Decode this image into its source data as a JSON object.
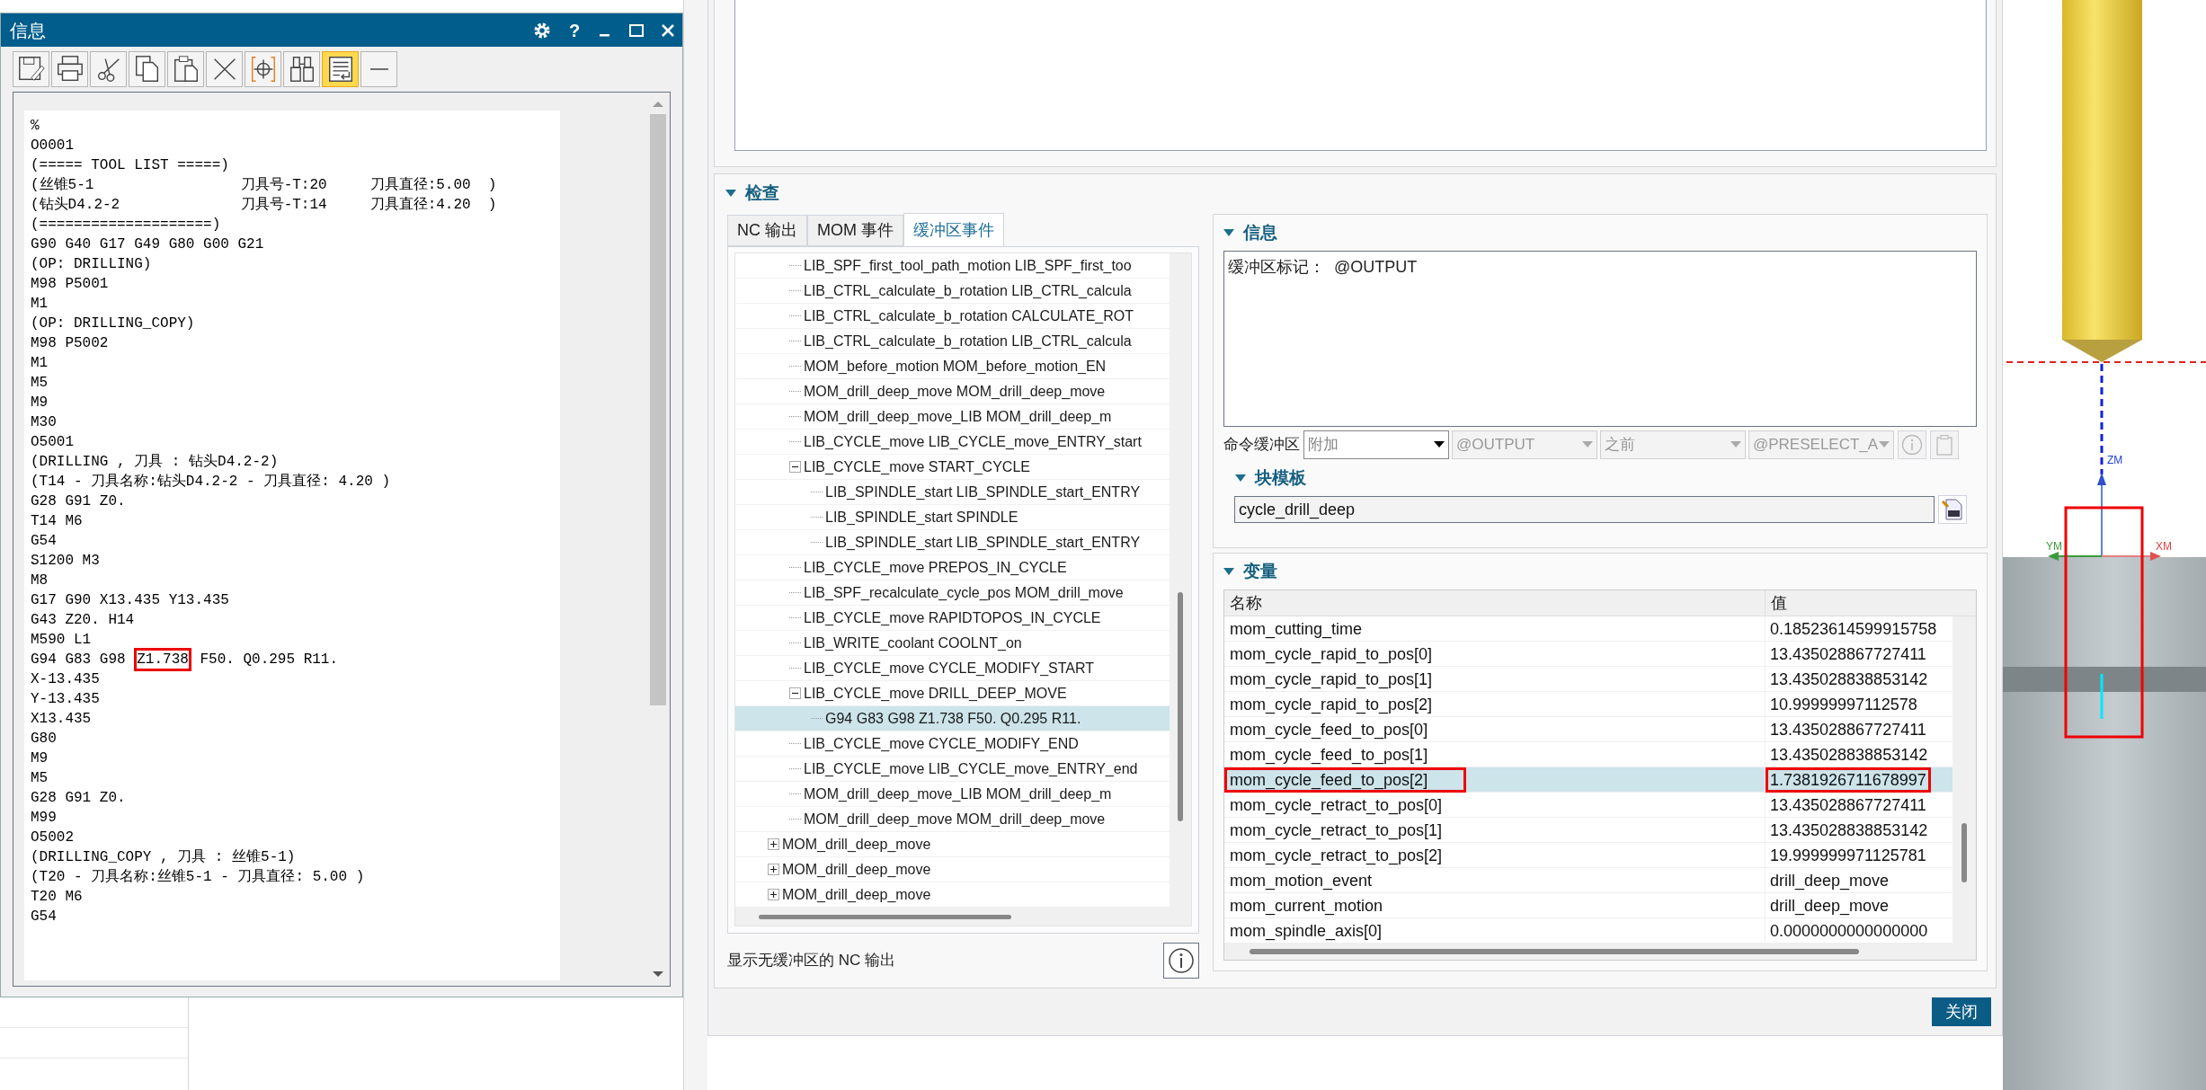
{
  "info_window": {
    "title": "信息",
    "help_label": "?",
    "toolbar": [
      {
        "kind": "save",
        "selected": false
      },
      {
        "kind": "print",
        "selected": false
      },
      {
        "kind": "cut",
        "selected": false
      },
      {
        "kind": "copy",
        "selected": false
      },
      {
        "kind": "paste",
        "selected": false
      },
      {
        "kind": "delete",
        "selected": false
      },
      {
        "kind": "crosshair",
        "selected": false
      },
      {
        "kind": "find",
        "selected": false
      },
      {
        "kind": "wrap",
        "selected": true
      },
      {
        "kind": "line",
        "selected": false
      }
    ],
    "lines": [
      "%",
      "O0001",
      "(===== TOOL LIST =====)",
      "(丝锥5-1                 刀具号-T:20     刀具直径:5.00  )",
      "(钻头D4.2-2              刀具号-T:14     刀具直径:4.20  )",
      "(====================)",
      "G90 G40 G17 G49 G80 G00 G21",
      "(OP: DRILLING)",
      "M98 P5001",
      "M1",
      "(OP: DRILLING_COPY)",
      "M98 P5002",
      "M1",
      "M5",
      "M9",
      "M30",
      "O5001",
      "(DRILLING , 刀具 : 钻头D4.2-2)",
      "(T14 - 刀具名称:钻头D4.2-2 - 刀具直径: 4.20 )",
      "G28 G91 Z0.",
      "T14 M6",
      "G54",
      "S1200 M3",
      "M8",
      "G17 G90 X13.435 Y13.435",
      "G43 Z20. H14",
      "M590 L1",
      {
        "segments": [
          {
            "text": "G94 G83 G98 ",
            "boxed": false
          },
          {
            "text": "Z1.738",
            "boxed": true
          },
          {
            "text": " F50. Q0.295 R11.",
            "boxed": false
          }
        ]
      },
      "X-13.435",
      "Y-13.435",
      "X13.435",
      "G80",
      "M9",
      "M5",
      "G28 G91 Z0.",
      "M99",
      "O5002",
      "(DRILLING_COPY , 刀具 : 丝锥5-1)",
      "(T20 - 刀具名称:丝锥5-1 - 刀具直径: 5.00 )",
      "T20 M6",
      "G54"
    ]
  },
  "dialog": {
    "inspect": {
      "title": "检查",
      "tabs": [
        {
          "label": "NC 输出",
          "selected": false
        },
        {
          "label": "MOM 事件",
          "selected": false
        },
        {
          "label": "缓冲区事件",
          "selected": true
        }
      ],
      "tree": {
        "continued_children": [
          {
            "label": "LIB_SPF_first_tool_path_motion LIB_SPF_first_too",
            "selected": false
          },
          {
            "label": "LIB_CTRL_calculate_b_rotation LIB_CTRL_calcula",
            "selected": false
          },
          {
            "label": "LIB_CTRL_calculate_b_rotation CALCULATE_ROT",
            "selected": false
          },
          {
            "label": "LIB_CTRL_calculate_b_rotation LIB_CTRL_calcula",
            "selected": false
          },
          {
            "label": "MOM_before_motion MOM_before_motion_EN",
            "selected": false
          },
          {
            "label": "MOM_drill_deep_move MOM_drill_deep_move",
            "selected": false
          },
          {
            "label": "MOM_drill_deep_move_LIB MOM_drill_deep_m",
            "selected": false
          },
          {
            "label": "LIB_CYCLE_move LIB_CYCLE_move_ENTRY_start",
            "selected": false
          },
          {
            "label": "LIB_CYCLE_move START_CYCLE",
            "selected": false,
            "expanded": true,
            "children": [
              {
                "label": "LIB_SPINDLE_start LIB_SPINDLE_start_ENTRY",
                "selected": false
              },
              {
                "label": "LIB_SPINDLE_start SPINDLE",
                "selected": false
              },
              {
                "label": "LIB_SPINDLE_start LIB_SPINDLE_start_ENTRY",
                "selected": false
              }
            ]
          },
          {
            "label": "LIB_CYCLE_move PREPOS_IN_CYCLE",
            "selected": false
          },
          {
            "label": "LIB_SPF_recalculate_cycle_pos MOM_drill_move",
            "selected": false
          },
          {
            "label": "LIB_CYCLE_move RAPIDTOPOS_IN_CYCLE",
            "selected": false
          },
          {
            "label": "LIB_WRITE_coolant COOLNT_on",
            "selected": false
          },
          {
            "label": "LIB_CYCLE_move CYCLE_MODIFY_START",
            "selected": false
          },
          {
            "label": "LIB_CYCLE_move DRILL_DEEP_MOVE",
            "selected": false,
            "expanded": true,
            "children": [
              {
                "label": "G94 G83 G98 Z1.738 F50. Q0.295 R11.",
                "selected": true
              }
            ]
          },
          {
            "label": "LIB_CYCLE_move CYCLE_MODIFY_END",
            "selected": false
          },
          {
            "label": "LIB_CYCLE_move LIB_CYCLE_move_ENTRY_end",
            "selected": false
          },
          {
            "label": "MOM_drill_deep_move_LIB MOM_drill_deep_m",
            "selected": false
          },
          {
            "label": "MOM_drill_deep_move MOM_drill_deep_move",
            "selected": false
          }
        ],
        "items": [
          {
            "label": "MOM_drill_deep_move",
            "selected": false,
            "expanded": false
          },
          {
            "label": "MOM_drill_deep_move",
            "selected": false,
            "expanded": false
          },
          {
            "label": "MOM_drill_deep_move",
            "selected": false,
            "expanded": false
          }
        ]
      },
      "footer": "显示无缓冲区的 NC 输出"
    },
    "info": {
      "title": "信息",
      "message": "缓冲区标记：  @OUTPUT",
      "command_label": "命令缓冲区",
      "dropdowns": [
        {
          "value": "附加",
          "disabled": false
        },
        {
          "value": "@OUTPUT",
          "disabled": true
        },
        {
          "value": "之前",
          "disabled": true
        },
        {
          "value": "@PRESELECT_A",
          "disabled": true
        }
      ],
      "block_template": {
        "title": "块模板",
        "value": "cycle_drill_deep"
      }
    },
    "variables": {
      "title": "变量",
      "columns": [
        "名称",
        "值"
      ],
      "rows": [
        {
          "name": "mom_cutting_time",
          "value": "0.18523614599915758",
          "selected": false,
          "annotated": false
        },
        {
          "name": "mom_cycle_rapid_to_pos[0]",
          "value": "13.435028867727411",
          "selected": false,
          "annotated": false
        },
        {
          "name": "mom_cycle_rapid_to_pos[1]",
          "value": "13.435028838853142",
          "selected": false,
          "annotated": false
        },
        {
          "name": "mom_cycle_rapid_to_pos[2]",
          "value": "10.99999997112578",
          "selected": false,
          "annotated": false
        },
        {
          "name": "mom_cycle_feed_to_pos[0]",
          "value": "13.435028867727411",
          "selected": false,
          "annotated": false
        },
        {
          "name": "mom_cycle_feed_to_pos[1]",
          "value": "13.435028838853142",
          "selected": false,
          "annotated": false
        },
        {
          "name": "mom_cycle_feed_to_pos[2]",
          "value": "1.7381926711678997",
          "selected": true,
          "annotated": true
        },
        {
          "name": "mom_cycle_retract_to_pos[0]",
          "value": "13.435028867727411",
          "selected": false,
          "annotated": false
        },
        {
          "name": "mom_cycle_retract_to_pos[1]",
          "value": "13.435028838853142",
          "selected": false,
          "annotated": false
        },
        {
          "name": "mom_cycle_retract_to_pos[2]",
          "value": "19.999999971125781",
          "selected": false,
          "annotated": false
        },
        {
          "name": "mom_motion_event",
          "value": "drill_deep_move",
          "selected": false,
          "annotated": false
        },
        {
          "name": "mom_current_motion",
          "value": "drill_deep_move",
          "selected": false,
          "annotated": false
        },
        {
          "name": "mom_spindle_axis[0]",
          "value": "0.0000000000000000",
          "selected": false,
          "annotated": false
        }
      ]
    },
    "close_button": "关闭"
  },
  "viewport": {
    "z_label": "ZM",
    "y_label": "YM",
    "x_label": "XM"
  }
}
